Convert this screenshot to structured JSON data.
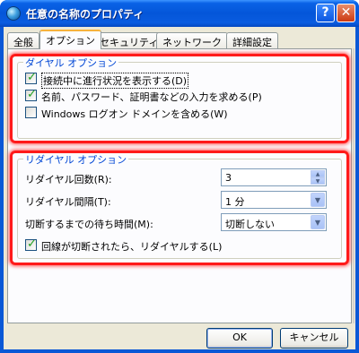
{
  "window": {
    "title": "任意の名称のプロパティ",
    "help_label": "?",
    "close_label": "✕",
    "icon": "network-connection-icon"
  },
  "tabs": [
    {
      "label": "全般",
      "active": false
    },
    {
      "label": "オプション",
      "active": true
    },
    {
      "label": "セキュリティ",
      "active": false
    },
    {
      "label": "ネットワーク",
      "active": false
    },
    {
      "label": "詳細設定",
      "active": false
    }
  ],
  "dial_options": {
    "title": "ダイヤル オプション",
    "items": [
      {
        "label": "接続中に進行状況を表示する(D)",
        "checked": true,
        "focused": true
      },
      {
        "label": "名前、パスワード、証明書などの入力を求める(P)",
        "checked": true,
        "focused": false
      },
      {
        "label": "Windows ログオン ドメインを含める(W)",
        "checked": false,
        "focused": false
      }
    ]
  },
  "redial_options": {
    "title": "リダイヤル オプション",
    "redial_count_label": "リダイヤル回数(R):",
    "redial_count_value": "3",
    "redial_interval_label": "リダイヤル間隔(T):",
    "redial_interval_value": "1 分",
    "idle_time_label": "切断するまでの待ち時間(M):",
    "idle_time_value": "切断しない",
    "redial_on_drop_label": "回線が切断されたら、リダイヤルする(L)",
    "redial_on_drop_checked": true
  },
  "buttons": {
    "ok": "OK",
    "cancel": "キャンセル"
  },
  "colors": {
    "highlight": "#ff1a1a",
    "group_title": "#0046d5",
    "titlebar": "#0456d9"
  }
}
